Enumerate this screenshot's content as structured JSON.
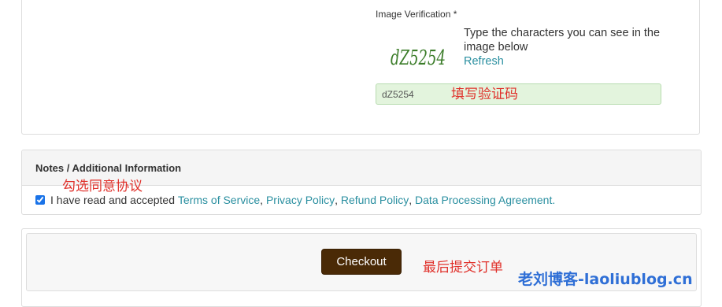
{
  "captcha": {
    "label": "Image Verification *",
    "image_text": "dZ5254",
    "help_text": "Type the characters you can see in the image below",
    "refresh_label": "Refresh",
    "input_value": "dZ5254"
  },
  "annotations": {
    "fill_code": "填写验证码",
    "check_agree": "勾选同意协议",
    "submit_order": "最后提交订单"
  },
  "notes": {
    "heading": "Notes / Additional Information",
    "accept_prefix": "I have read and accepted",
    "links": [
      "Terms of Service",
      "Privacy Policy",
      "Refund Policy",
      "Data Processing Agreement"
    ],
    "checked": true
  },
  "checkout": {
    "button_label": "Checkout"
  },
  "watermark": "老刘博客-laoliublog.cn",
  "colors": {
    "link": "#2a8fa0",
    "annotation": "#e0302a",
    "checkout_bg": "#4a2a06",
    "captcha_input_bg": "#e3f4dd",
    "watermark": "#2f6fd6"
  }
}
